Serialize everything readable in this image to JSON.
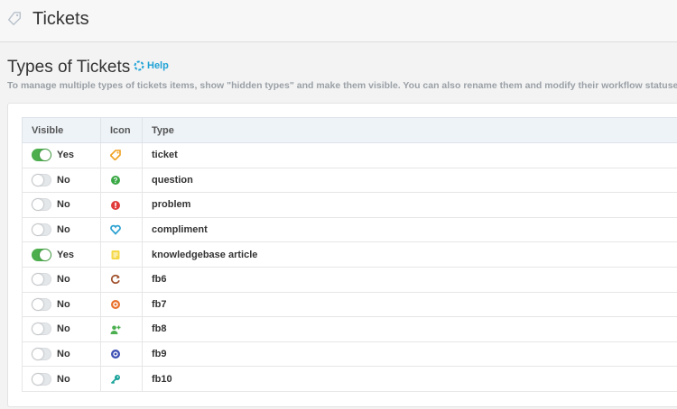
{
  "header": {
    "title": "Tickets",
    "icon": "ticket-tag-icon"
  },
  "section": {
    "title": "Types of Tickets",
    "help_label": "Help",
    "description": "To manage multiple types of tickets items, show \"hidden types\" and make them visible. You can also rename them and modify their workflow statuses."
  },
  "table": {
    "columns": [
      "Visible",
      "Icon",
      "Type"
    ],
    "rows": [
      {
        "visible": "Yes",
        "on": true,
        "icon": "ticket-icon",
        "color": "#f0a020",
        "type": "ticket"
      },
      {
        "visible": "No",
        "on": false,
        "icon": "question-icon",
        "color": "#3aa845",
        "type": "question"
      },
      {
        "visible": "No",
        "on": false,
        "icon": "problem-icon",
        "color": "#e03a3a",
        "type": "problem"
      },
      {
        "visible": "No",
        "on": false,
        "icon": "heart-icon",
        "color": "#2aa0d0",
        "type": "compliment"
      },
      {
        "visible": "Yes",
        "on": true,
        "icon": "document-icon",
        "color": "#f5d848",
        "type": "knowledgebase article"
      },
      {
        "visible": "No",
        "on": false,
        "icon": "refresh-icon",
        "color": "#a0522d",
        "type": "fb6"
      },
      {
        "visible": "No",
        "on": false,
        "icon": "target-icon",
        "color": "#e8702a",
        "type": "fb7"
      },
      {
        "visible": "No",
        "on": false,
        "icon": "user-add-icon",
        "color": "#4caf50",
        "type": "fb8"
      },
      {
        "visible": "No",
        "on": false,
        "icon": "at-icon",
        "color": "#3f51b5",
        "type": "fb9"
      },
      {
        "visible": "No",
        "on": false,
        "icon": "key-icon",
        "color": "#1aa39a",
        "type": "fb10"
      }
    ]
  }
}
